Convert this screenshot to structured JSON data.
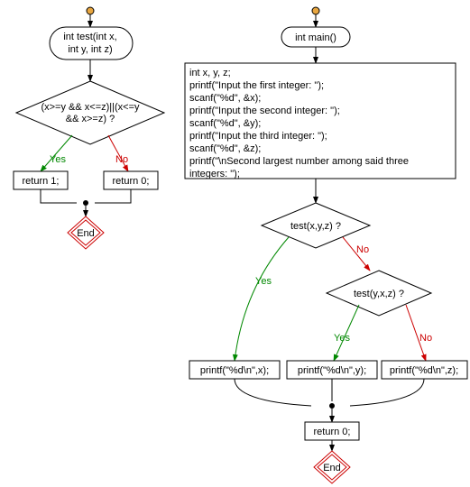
{
  "left": {
    "func_sig": [
      "int test(int x,",
      "int y, int z)"
    ],
    "cond": [
      "(x>=y && x<=z)||(x<=y",
      "&& x>=z) ?"
    ],
    "yes": "Yes",
    "no": "No",
    "ret1": "return 1;",
    "ret0": "return 0;",
    "end": "End"
  },
  "right": {
    "main_sig": "int main()",
    "body": [
      "int x, y, z;",
      "printf(\"Input the first integer: \");",
      "scanf(\"%d\", &x);",
      "printf(\"Input the second integer: \");",
      "scanf(\"%d\", &y);",
      "printf(\"Input the third integer: \");",
      "scanf(\"%d\", &z);",
      "printf(\"\\nSecond largest number among said three",
      "integers: \");"
    ],
    "cond1": "test(x,y,z) ?",
    "cond2": "test(y,x,z) ?",
    "yes": "Yes",
    "no": "No",
    "printx": "printf(\"%d\\n\",x);",
    "printy": "printf(\"%d\\n\",y);",
    "printz": "printf(\"%d\\n\",z);",
    "ret0": "return 0;",
    "end": "End"
  }
}
